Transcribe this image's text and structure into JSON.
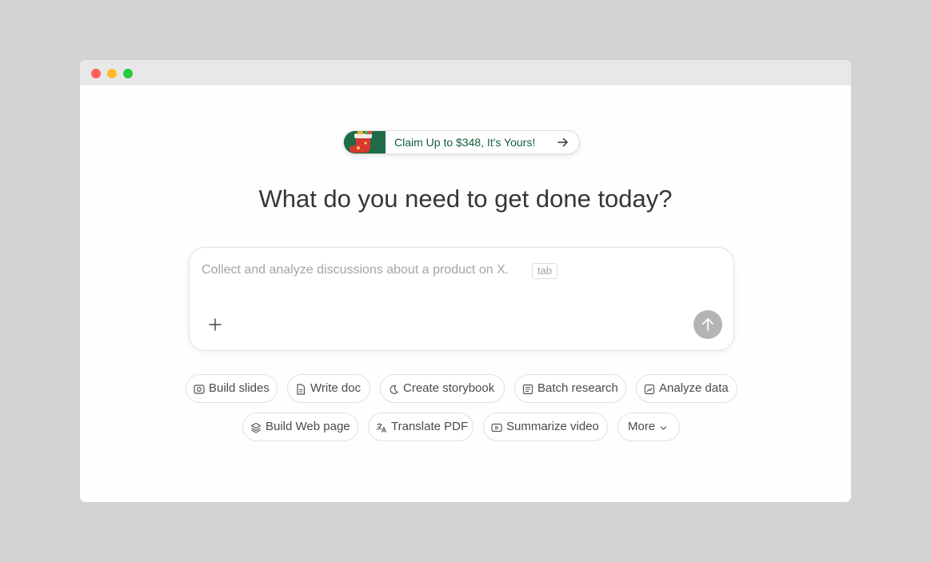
{
  "promo": {
    "text": "Claim Up to $348, It's Yours!",
    "art_icon": "christmas-stocking-icon",
    "arrow_icon": "arrow-right-icon",
    "colors": {
      "banner_bg": "#1f6b47",
      "text": "#155e3b"
    }
  },
  "headline": "What do you need to get done today?",
  "composer": {
    "placeholder": "Collect and analyze discussions about a product on X.",
    "tab_hint": "tab",
    "attach_icon": "plus-icon",
    "send_icon": "arrow-up-icon",
    "colors": {
      "send_bg": "#b4b4b4"
    }
  },
  "quick_actions": [
    {
      "label": "Build slides",
      "icon": "slides-icon"
    },
    {
      "label": "Write doc",
      "icon": "document-icon"
    },
    {
      "label": "Create storybook",
      "icon": "moon-icon"
    },
    {
      "label": "Batch research",
      "icon": "research-icon"
    },
    {
      "label": "Analyze data",
      "icon": "chart-icon"
    },
    {
      "label": "Build Web page",
      "icon": "layers-icon"
    },
    {
      "label": "Translate PDF",
      "icon": "translate-icon"
    },
    {
      "label": "Summarize video",
      "icon": "video-icon"
    },
    {
      "label": "More",
      "icon": "chevron-down-icon"
    }
  ],
  "window": {
    "controls": [
      "close",
      "minimize",
      "maximize"
    ],
    "colors": {
      "close": "#fe5f57",
      "minimize": "#febc2e",
      "maximize": "#28c840"
    }
  }
}
